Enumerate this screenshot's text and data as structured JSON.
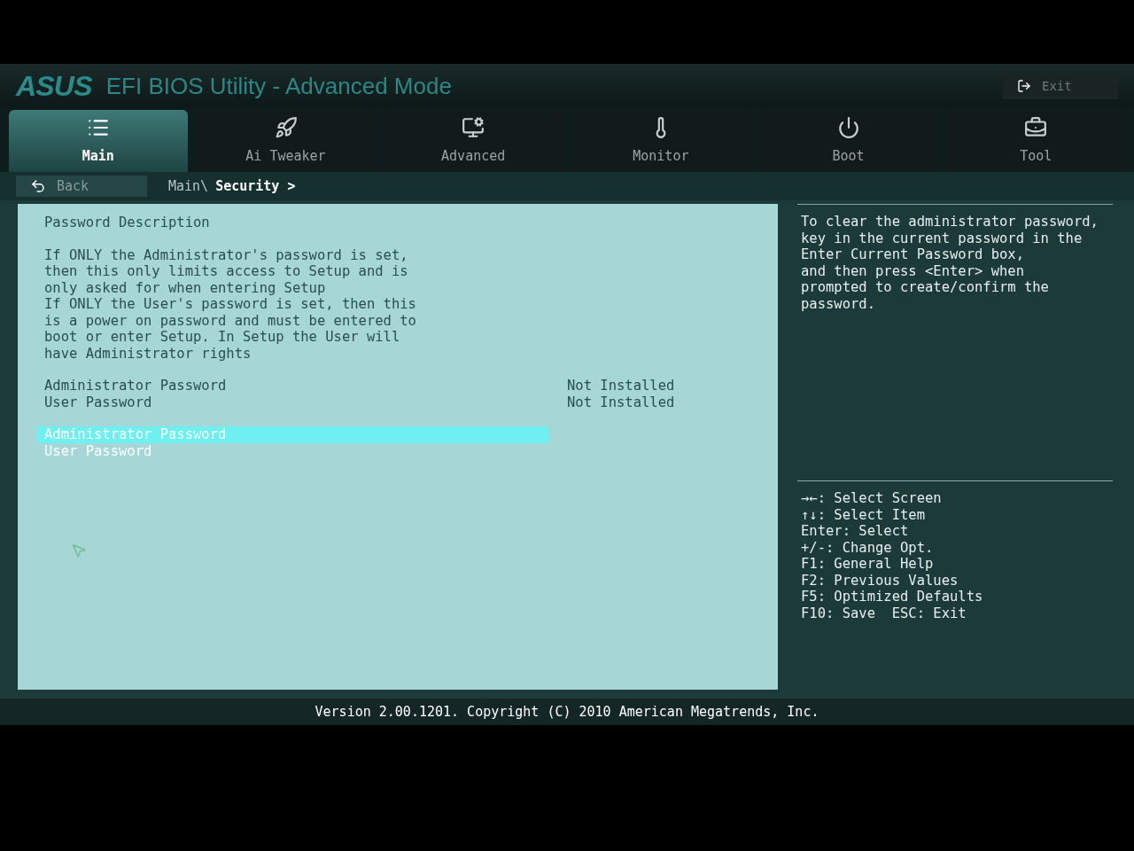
{
  "header": {
    "logo": "ASUS",
    "title": "EFI BIOS Utility - Advanced Mode",
    "exit_label": "Exit"
  },
  "tabs": [
    {
      "label": "Main",
      "selected": true
    },
    {
      "label": "Ai Tweaker",
      "selected": false
    },
    {
      "label": "Advanced",
      "selected": false
    },
    {
      "label": "Monitor",
      "selected": false
    },
    {
      "label": "Boot",
      "selected": false
    },
    {
      "label": "Tool",
      "selected": false
    }
  ],
  "breadcrumb": {
    "back": "Back",
    "path": "Main\\",
    "current": "Security >"
  },
  "main": {
    "section_title": "Password Description",
    "description_lines": [
      "If ONLY the Administrator's password is set,",
      "then this only limits access to Setup and is",
      "only asked for when entering Setup",
      "If ONLY the User's password is set, then this",
      "is a power on password and must be entered to",
      "boot or enter Setup. In Setup the User will",
      "have Administrator rights"
    ],
    "status_rows": [
      {
        "label": "Administrator Password",
        "value": "Not Installed"
      },
      {
        "label": "User Password",
        "value": "Not Installed"
      }
    ],
    "menu_items": [
      {
        "label": "Administrator Password",
        "selected": true
      },
      {
        "label": "User Password",
        "selected": false
      }
    ]
  },
  "help": {
    "lines": [
      "To clear the administrator password,",
      "key in the current password in the",
      "Enter Current Password box,",
      "and then press <Enter> when",
      "prompted to create/confirm the",
      "password."
    ]
  },
  "keys": [
    "→←: Select Screen",
    "↑↓: Select Item",
    "Enter: Select",
    "+/-: Change Opt.",
    "F1: General Help",
    "F2: Previous Values",
    "F5: Optimized Defaults",
    "F10: Save  ESC: Exit"
  ],
  "footer": "Version 2.00.1201. Copyright (C) 2010 American Megatrends, Inc."
}
